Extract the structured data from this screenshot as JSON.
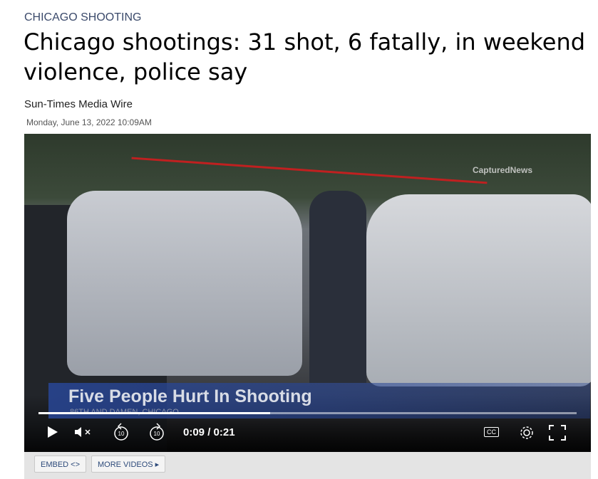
{
  "article": {
    "kicker": "CHICAGO SHOOTING",
    "headline": "Chicago shootings: 31 shot, 6 fatally, in weekend violence, police say",
    "byline": "Sun-Times Media Wire",
    "date": "Monday, June 13, 2022 10:09AM"
  },
  "video": {
    "watermark": "CapturedNews",
    "lower_third_title": "Five People Hurt In Shooting",
    "lower_third_sub": "86TH AND DAMEN, CHICAGO",
    "current_time": "0:09",
    "duration": "/ 0:21",
    "progress": 0.43,
    "cc_label": "CC",
    "skip_seconds": "10"
  },
  "actions": {
    "embed": "EMBED <>",
    "more_videos": "MORE VIDEOS ▸"
  }
}
